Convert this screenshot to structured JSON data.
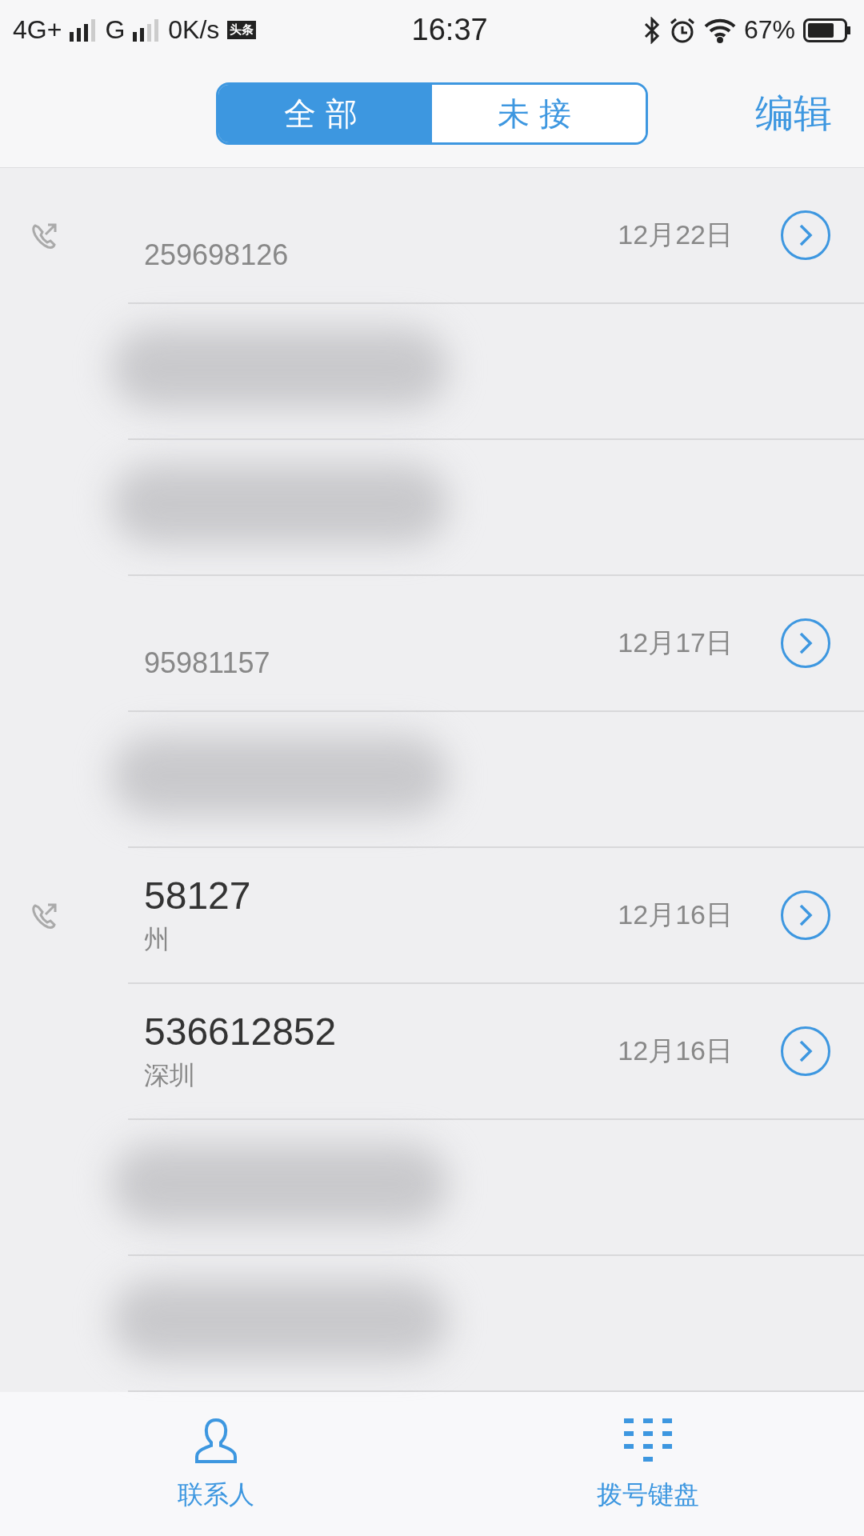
{
  "status_bar": {
    "network": "4G+",
    "network2": "G",
    "speed": "0K/s",
    "app_badge": "头条",
    "time": "16:37",
    "battery": "67%"
  },
  "segments": [
    {
      "label": "全部",
      "selected": true
    },
    {
      "label": "未接",
      "selected": false
    }
  ],
  "edit_button": "编辑",
  "calls": [
    {
      "kind": "entry",
      "outgoing": true,
      "number": "259698126",
      "date": "12月22日"
    },
    {
      "kind": "smudged"
    },
    {
      "kind": "smudged"
    },
    {
      "kind": "entry",
      "outgoing": false,
      "number": "95981157",
      "date": "12月17日"
    },
    {
      "kind": "smudged"
    },
    {
      "kind": "entry",
      "outgoing": true,
      "number": "58127",
      "location": "州",
      "date": "12月16日"
    },
    {
      "kind": "entry",
      "outgoing": false,
      "number": "536612852",
      "location": "深圳",
      "date": "12月16日"
    },
    {
      "kind": "smudged"
    },
    {
      "kind": "smudged"
    }
  ],
  "tab_bar": [
    {
      "kind": "contacts",
      "label": "联系人"
    },
    {
      "kind": "keypad",
      "label": "拨号键盘"
    }
  ]
}
